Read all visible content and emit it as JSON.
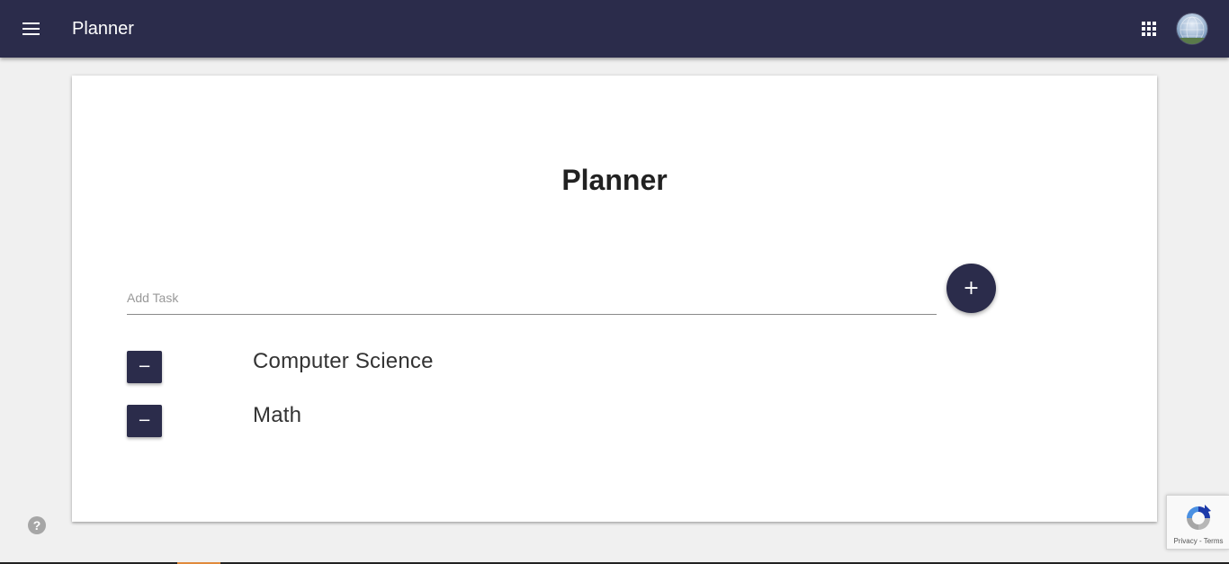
{
  "header": {
    "app_title": "Planner",
    "menu_icon": "hamburger-menu-icon",
    "apps_icon": "apps-grid-icon",
    "avatar": "user-avatar"
  },
  "main": {
    "title": "Planner",
    "add_task": {
      "placeholder": "Add Task",
      "value": "",
      "button_label": "+"
    },
    "tasks": [
      {
        "label": "Computer Science",
        "remove_label": "−"
      },
      {
        "label": "Math",
        "remove_label": "−"
      }
    ]
  },
  "footer": {
    "help_icon": "help-circle-icon",
    "help_label": "?",
    "recaptcha": {
      "privacy_label": "Privacy",
      "separator": "-",
      "terms_label": "Terms"
    }
  },
  "colors": {
    "primary": "#2b2c4b",
    "background": "#f0f0f0",
    "card": "#ffffff"
  }
}
